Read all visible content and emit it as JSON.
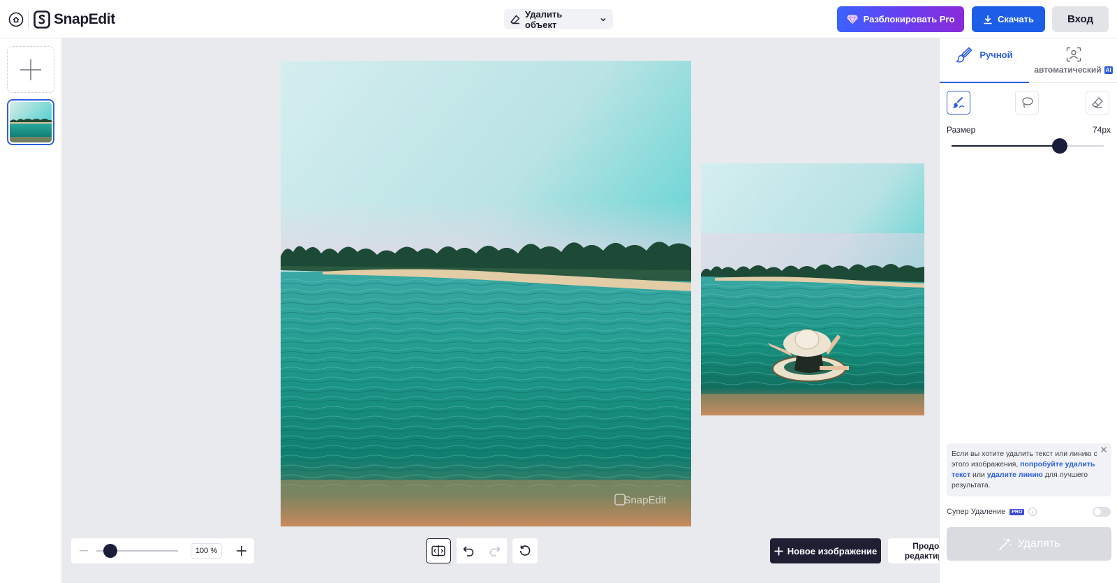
{
  "app": {
    "name": "SnapEdit"
  },
  "header": {
    "tool_select": "Удалить объект",
    "pro_button": "Разблокировать Pro",
    "download_button": "Скачать",
    "login_button": "Вход"
  },
  "canvas": {
    "watermark": "SnapEdit",
    "zoom_value": "100 %",
    "zoom_level": 0.1,
    "new_image_button": "Новое изображение",
    "continue_button_line1": "Продолжить",
    "continue_button_line2": "редактирование"
  },
  "panel": {
    "tab_manual": "Ручной",
    "tab_auto": "автоматический",
    "ai_badge": "AI",
    "size_label": "Размер",
    "size_value": "74px",
    "size_fraction": 0.71,
    "tip": {
      "part1": "Если вы хотите удалить текст или линию с этого изображения,",
      "link1": "попробуйте удалить текст",
      "part2": "или",
      "link2": "удалите линию",
      "part3": "для лучшего результата."
    },
    "super_label": "Супер Удаление",
    "pro_badge": "PRO",
    "info_glyph": "i",
    "remove_button": "Удалять"
  },
  "colors": {
    "accent": "#2f5fe0",
    "dark": "#1b1e3a",
    "canvas_bg": "#e9eaee"
  },
  "icons": [
    "home-icon",
    "snapedit-logo-icon",
    "eraser-icon",
    "chevron-down-icon",
    "diamond-icon",
    "download-icon",
    "plus-icon",
    "brush-icon",
    "ai-scan-icon",
    "lasso-icon",
    "eraser-icon",
    "close-icon",
    "compare-icon",
    "undo-icon",
    "redo-icon",
    "reset-icon",
    "chevron-right-icon",
    "magic-wand-icon"
  ]
}
